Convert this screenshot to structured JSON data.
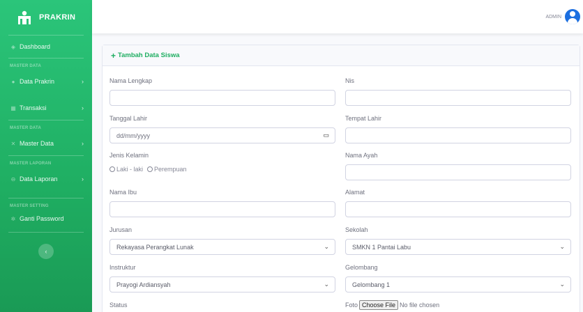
{
  "sidebar": {
    "brand": "PRAKRIN",
    "dashboard": "Dashboard",
    "heading_data": "MASTER DATA",
    "data_prakrin": "Data Prakrin",
    "transaksi": "Transaksi",
    "heading_data2": "MASTER DATA",
    "master_data": "Master Data",
    "heading_laporan": "MASTER LAPORAN",
    "data_laporan": "Data Laporan",
    "heading_setting": "MASTER SETTING",
    "ganti_password": "Ganti Password",
    "toggle_symbol": "‹"
  },
  "topbar": {
    "user": "ADMIN"
  },
  "form": {
    "title": "Tambah Data Siswa",
    "nama_lengkap": "Nama Lengkap",
    "nis": "Nis",
    "tanggal_lahir": "Tanggal Lahir",
    "tanggal_placeholder": "dd/mm/yyyy",
    "tempat_lahir": "Tempat Lahir",
    "jenis_kelamin": "Jenis Kelamin",
    "laki": "Laki - laki",
    "perempuan": "Perempuan",
    "nama_ayah": "Nama Ayah",
    "nama_ibu": "Nama Ibu",
    "alamat": "Alamat",
    "jurusan": "Jurusan",
    "jurusan_value": "Rekayasa Perangkat Lunak",
    "sekolah": "Sekolah",
    "sekolah_value": "SMKN 1 Pantai Labu",
    "instruktur": "Instruktur",
    "instruktur_value": "Prayogi Ardiansyah",
    "gelombang": "Gelombang",
    "gelombang_value": "Gelombang 1",
    "status": "Status",
    "foto": "Foto",
    "choose_file": "Choose File",
    "no_file": "No file chosen"
  }
}
